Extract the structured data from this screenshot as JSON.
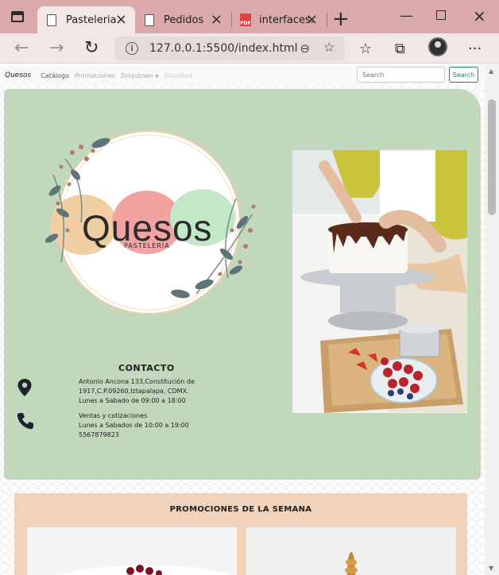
{
  "browser": {
    "tabs": [
      {
        "label": "Pasteleria",
        "active": true
      },
      {
        "label": "Pedidos",
        "active": false
      },
      {
        "label": "interfaces.",
        "active": false
      }
    ],
    "url": "127.0.0.1:5500/index.html"
  },
  "nav": {
    "brand": "Quesos",
    "links": [
      "Catálogo",
      "Promociones",
      "Dropdown",
      "Disabled"
    ],
    "search_placeholder": "Search",
    "search_button": "Search"
  },
  "logo": {
    "title": "Quesos",
    "subtitle": "PASTELERIA"
  },
  "contact": {
    "title": "CONTACTO",
    "address_lines": [
      "Antonio Ancona 133,Constitución de",
      "1917,C.P.09260,Iztapalapa, CDMX.",
      "Lunes a Sabado de 09:00 a 18:00"
    ],
    "sales_lines": [
      "Ventas y cotizaciones",
      "Lunes a Sabados de 10:00 a 19:00",
      "5567879823"
    ]
  },
  "promotions": {
    "title": "PROMOCIONES DE LA SEMANA"
  },
  "colors": {
    "tabbar": "#dba9a9",
    "hero": "#c2d8bd",
    "promo": "#f1d3bc",
    "accent": "#198754"
  }
}
